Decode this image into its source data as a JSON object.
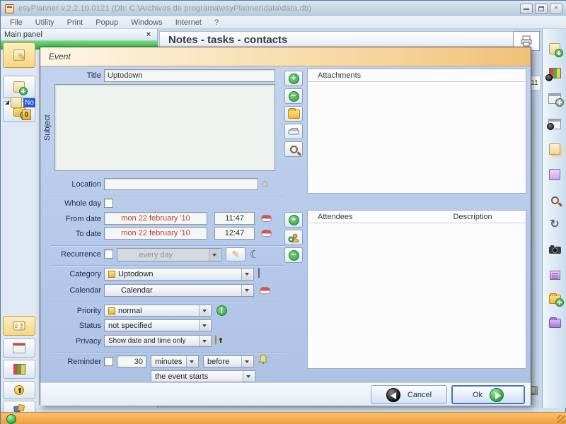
{
  "window": {
    "title": "esyPlanner v.2.2.10.0121 (Db: C:\\Archivos de programa\\esyPlanner\\data\\data.db)",
    "menu": [
      "File",
      "Utility",
      "Print",
      "Popup",
      "Windows",
      "Internet",
      "?"
    ]
  },
  "main_panel": {
    "title": "Main panel",
    "close_label": "×",
    "tree_item_label": "No",
    "tree_badge": "0"
  },
  "content": {
    "heading": "Notes - tasks - contacts",
    "calendar_day": "11"
  },
  "dialog": {
    "title": "Event",
    "form": {
      "title_label": "Title",
      "title_value": "Uptodown",
      "subject_label": "Subject",
      "subject_value": "",
      "location_label": "Location",
      "location_value": "",
      "whole_day_label": "Whole day",
      "from_date_label": "From date",
      "from_date_value": "mon 22 february '10",
      "from_time_value": "11:47",
      "to_date_label": "To date",
      "to_date_value": "mon 22 february '10",
      "to_time_value": "12:47",
      "recurrence_label": "Recurrence",
      "recurrence_value": "every day",
      "category_label": "Category",
      "category_value": "Uptodown",
      "calendar_label": "Calendar",
      "calendar_value": "Calendar",
      "priority_label": "Priority",
      "priority_value": "normal",
      "status_label": "Status",
      "status_value": "not specified",
      "privacy_label": "Privacy",
      "privacy_value": "Show date and time only",
      "reminder_label": "Reminder",
      "reminder_value": "30",
      "reminder_unit_value": "minutes",
      "reminder_relation_value": "before",
      "reminder_event_value": "the event starts"
    },
    "attachments_header": "Attachments",
    "attendees_header": "Attendees",
    "description_header": "Description",
    "cancel_label": "Cancel",
    "ok_label": "Ok",
    "priority_icon_glyph": "!"
  },
  "icons": {
    "pencil": "✎",
    "house": "⌂",
    "moon": "☾",
    "refresh": "↻"
  },
  "colors": {
    "dialog_header_accent": "#f0c078",
    "dialog_body": "#b5c8ea",
    "status_bar_orange": "#ef9d38",
    "date_text_red": "#c23b2e",
    "green_accent": "#2f9e3c",
    "panel_green_bar": "#2fae3e"
  }
}
